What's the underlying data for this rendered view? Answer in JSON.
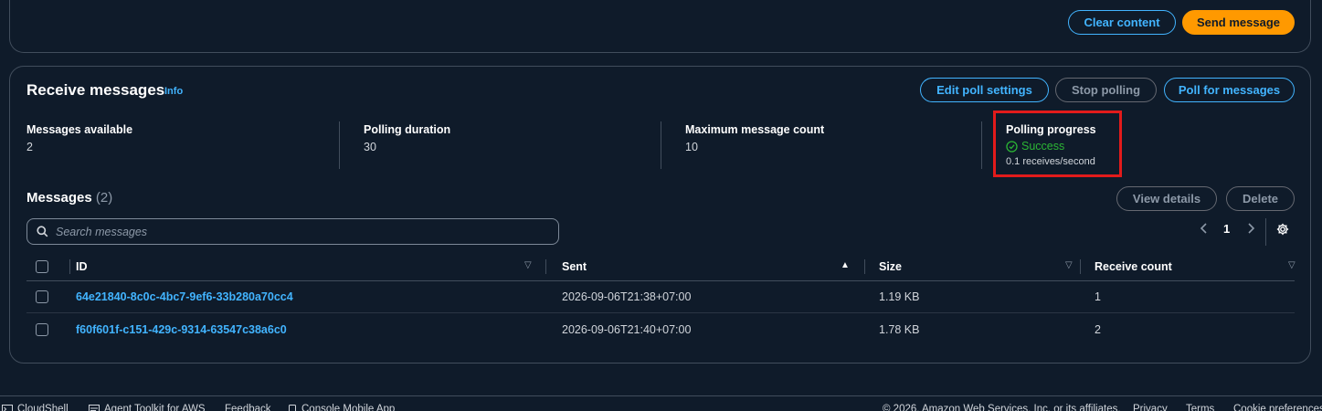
{
  "top": {
    "clear_label": "Clear content",
    "send_label": "Send message"
  },
  "receive": {
    "title": "Receive messages",
    "info": "Info",
    "edit_poll_label": "Edit poll settings",
    "stop_polling_label": "Stop polling",
    "poll_label": "Poll for messages",
    "stats": {
      "available_label": "Messages available",
      "available_value": "2",
      "duration_label": "Polling duration",
      "duration_value": "30",
      "max_label": "Maximum message count",
      "max_value": "10",
      "progress_label": "Polling progress",
      "progress_status": "Success",
      "progress_rate": "0.1 receives/second"
    }
  },
  "messages": {
    "title": "Messages",
    "count": "(2)",
    "view_details_label": "View details",
    "delete_label": "Delete",
    "search_placeholder": "Search messages",
    "page": "1",
    "columns": {
      "id": "ID",
      "sent": "Sent",
      "size": "Size",
      "receive_count": "Receive count"
    },
    "rows": [
      {
        "id": "64e21840-8c0c-4bc7-9ef6-33b280a70cc4",
        "sent": "2026-09-06T21:38+07:00",
        "size": "1.19 KB",
        "receive_count": "1"
      },
      {
        "id": "f60f601f-c151-429c-9314-63547c38a6c0",
        "sent": "2026-09-06T21:40+07:00",
        "size": "1.78 KB",
        "receive_count": "2"
      }
    ]
  },
  "footer": {
    "cloudshell": "CloudShell",
    "agent_toolkit": "Agent Toolkit for AWS",
    "feedback": "Feedback",
    "console_mobile": "Console Mobile App",
    "copyright": "© 2026, Amazon Web Services, Inc. or its affiliates.",
    "privacy": "Privacy",
    "terms": "Terms",
    "cookie": "Cookie preferences"
  },
  "colors": {
    "background": "#0f1b2a",
    "accent": "#42b4ff",
    "primary": "#ff9900",
    "success": "#2bb534",
    "highlight": "#e21b1b"
  }
}
